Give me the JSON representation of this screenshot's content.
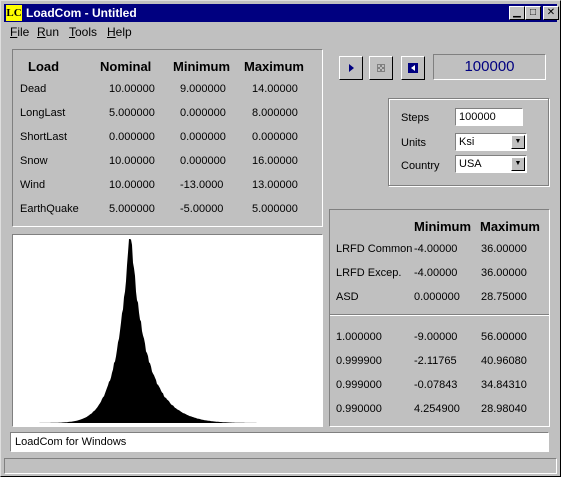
{
  "window": {
    "title": "LoadCom - Untitled",
    "app_icon": "LC"
  },
  "menu": [
    {
      "label": "File",
      "accel": "F",
      "rest": "ile"
    },
    {
      "label": "Run",
      "accel": "R",
      "rest": "un"
    },
    {
      "label": "Tools",
      "accel": "T",
      "rest": "ools"
    },
    {
      "label": "Help",
      "accel": "H",
      "rest": "elp"
    }
  ],
  "loads": {
    "headers": [
      "Load",
      "Nominal",
      "Minimum",
      "Maximum"
    ],
    "rows": [
      [
        "Dead",
        "10.00000",
        "9.000000",
        "14.00000"
      ],
      [
        "LongLast",
        "5.000000",
        "0.000000",
        "8.000000"
      ],
      [
        "ShortLast",
        "0.000000",
        "0.000000",
        "0.000000"
      ],
      [
        "Snow",
        "10.00000",
        "0.000000",
        "16.00000"
      ],
      [
        "Wind",
        "10.00000",
        "-13.0000",
        "13.00000"
      ],
      [
        "EarthQuake",
        "5.000000",
        "-5.00000",
        "5.000000"
      ]
    ]
  },
  "toolbar": {
    "play_icon": "play-icon",
    "stop_icon": "stop-icon",
    "reset_icon": "reset-icon",
    "counter": "100000"
  },
  "settings": {
    "steps_label": "Steps",
    "steps_value": "100000",
    "units_label": "Units",
    "units_value": "Ksi",
    "country_label": "Country",
    "country_value": "USA"
  },
  "results": {
    "headers": [
      "Minimum",
      "Maximum"
    ],
    "rows": [
      [
        "LRFD Common",
        "-4.00000",
        "36.00000"
      ],
      [
        "LRFD Excep.",
        "-4.00000",
        "36.00000"
      ],
      [
        "ASD",
        "0.000000",
        "28.75000"
      ]
    ]
  },
  "fractiles": {
    "rows": [
      [
        "1.000000",
        "-9.00000",
        "56.00000"
      ],
      [
        "0.999900",
        "-2.11765",
        "40.96080"
      ],
      [
        "0.999000",
        "-0.07843",
        "34.84310"
      ],
      [
        "0.990000",
        "4.254900",
        "28.98040"
      ]
    ]
  },
  "status_text": "LoadCom for Windows",
  "histogram": {
    "peak_fraction": 0.27,
    "color": "#000000"
  }
}
